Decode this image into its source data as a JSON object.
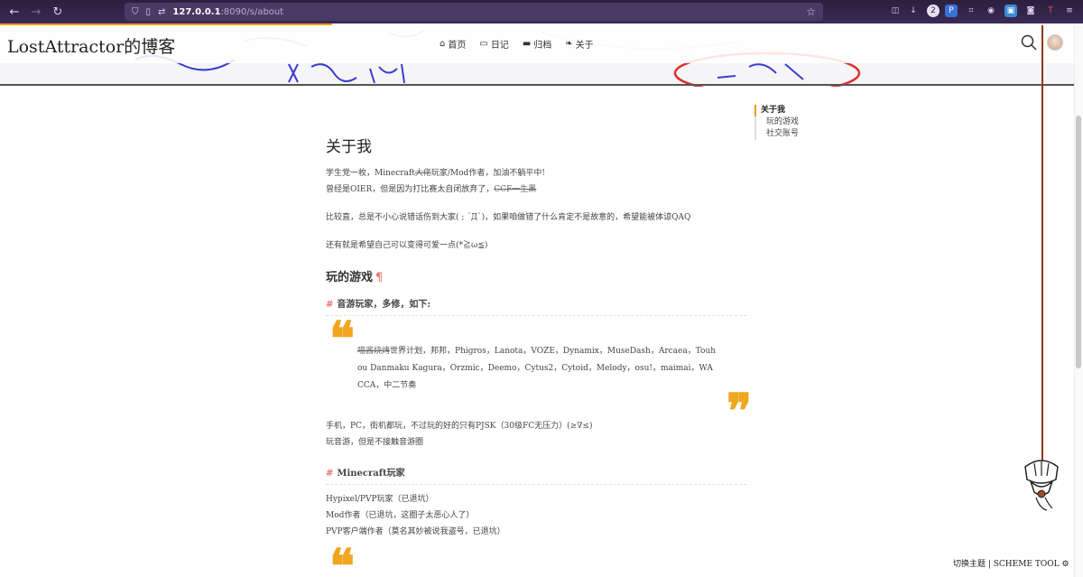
{
  "browser": {
    "url_host": "127.0.0.1",
    "url_rest": ":8090/s/about",
    "back_icon": "arrow-left",
    "forward_icon": "arrow-right",
    "reload_icon": "reload",
    "ext_badge": "2"
  },
  "site": {
    "title": "LostAttractor的博客"
  },
  "menu": [
    {
      "icon": "home-icon",
      "glyph": "⌂",
      "label": "首页"
    },
    {
      "icon": "calendar-icon",
      "glyph": "▭",
      "label": "日记"
    },
    {
      "icon": "archive-icon",
      "glyph": "▬",
      "label": "归档"
    },
    {
      "icon": "leaf-icon",
      "glyph": "❧",
      "label": "关于"
    }
  ],
  "article": {
    "title": "关于我",
    "intro_line1": "学生党一枚，Minecraft",
    "intro_line1_strike": "大佬",
    "intro_line1_rest": "玩家/Mod作者，加油不躺平中!",
    "intro_line2": "曾经是OIER，但是因为打比赛太自闭放弃了，",
    "intro_line2_strike": "CCF一生黑",
    "para2": "比较直，总是不小心说错话伤到大家( ; ´Д`)，如果咱做错了什么肯定不是故意的，希望能被体谅QAQ",
    "para3": "还有就是希望自己可以变得可爱一点(*≧ω≦)",
    "section_games": "玩的游戏",
    "pilcrow": "¶",
    "sub_music": "音游玩家，多修，如下:",
    "quote_strike": "喵酱烧烤",
    "quote_text": "世界计划，邦邦，Phigros，Lanota，VOZE，Dynamix，MuseDash，Arcaea，Touhou Danmaku Kagura，Orzmic，Deemo，Cytus2，Cytoid，Melody，osu!，maimai，WACCA，中二节奏",
    "music_line1": "手机，PC，街机都玩，不过玩的好的只有PJSK（30级FC无压力）(≥∇≤)",
    "music_line2": "玩音游，但是不接触音游圈",
    "sub_minecraft": "Minecraft玩家",
    "mc_line1": "Hypixel/PVP玩家（已退坑）",
    "mc_line2": "Mod作者（已退坑，这圈子太恶心人了）",
    "mc_line3": "PVP客户端作者（莫名其妙被说我盗号，已退坑）",
    "hash": "#",
    "open_quote": "❝",
    "close_quote": "❞"
  },
  "toc": {
    "active": "关于我",
    "items": [
      "玩的游戏",
      "社交账号"
    ]
  },
  "footer": {
    "scheme_tool": "切换主题 | SCHEME TOOL ⚙"
  },
  "colors": {
    "accent": "#f39c12",
    "quote": "#f0a61e",
    "heading_mark": "#e8726d",
    "chrome": "#2b1f3f"
  }
}
